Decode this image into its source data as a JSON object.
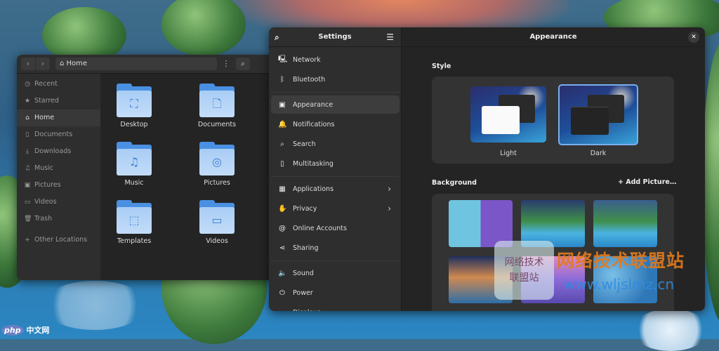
{
  "files": {
    "path": "Home",
    "sidebar": [
      {
        "label": "Recent",
        "icon": "clock-icon"
      },
      {
        "label": "Starred",
        "icon": "star-icon"
      },
      {
        "label": "Home",
        "icon": "home-icon",
        "selected": true
      },
      {
        "label": "Documents",
        "icon": "document-icon"
      },
      {
        "label": "Downloads",
        "icon": "download-icon"
      },
      {
        "label": "Music",
        "icon": "music-icon"
      },
      {
        "label": "Pictures",
        "icon": "picture-icon"
      },
      {
        "label": "Videos",
        "icon": "video-icon"
      },
      {
        "label": "Trash",
        "icon": "trash-icon"
      },
      {
        "label": "Other Locations",
        "icon": "plus-icon"
      }
    ],
    "folders": [
      {
        "label": "Desktop",
        "glyph": "⛶"
      },
      {
        "label": "Documents",
        "glyph": "🗋"
      },
      {
        "label": "Music",
        "glyph": "♫"
      },
      {
        "label": "Pictures",
        "glyph": "◎"
      },
      {
        "label": "Templates",
        "glyph": "⬚"
      },
      {
        "label": "Videos",
        "glyph": "▭"
      }
    ]
  },
  "settings": {
    "title": "Settings",
    "items": [
      {
        "label": "Network",
        "icon": "network-icon"
      },
      {
        "label": "Bluetooth",
        "icon": "bluetooth-icon"
      },
      {
        "label": "Appearance",
        "icon": "appearance-icon",
        "selected": true
      },
      {
        "label": "Notifications",
        "icon": "bell-icon"
      },
      {
        "label": "Search",
        "icon": "search-icon"
      },
      {
        "label": "Multitasking",
        "icon": "multitasking-icon"
      },
      {
        "label": "Applications",
        "icon": "apps-icon",
        "chevron": true
      },
      {
        "label": "Privacy",
        "icon": "hand-icon",
        "chevron": true
      },
      {
        "label": "Online Accounts",
        "icon": "at-icon"
      },
      {
        "label": "Sharing",
        "icon": "share-icon"
      },
      {
        "label": "Sound",
        "icon": "speaker-icon"
      },
      {
        "label": "Power",
        "icon": "power-icon"
      },
      {
        "label": "Displays",
        "icon": "display-icon"
      }
    ]
  },
  "appearance": {
    "title": "Appearance",
    "style_heading": "Style",
    "styles": [
      {
        "label": "Light"
      },
      {
        "label": "Dark",
        "selected": true
      }
    ],
    "background_heading": "Background",
    "add_picture": "Add Picture…"
  },
  "watermark": {
    "cn": "网络技术联盟站",
    "url": "www.wljslmz.cn",
    "badge_line1": "网络技术",
    "badge_line2": "联盟站"
  },
  "corner_logo": {
    "mark": "php",
    "text": "中文网"
  },
  "colors": {
    "accent": "#78aeed",
    "folder": "#4a90e2",
    "selection": "#3d3d3d"
  }
}
